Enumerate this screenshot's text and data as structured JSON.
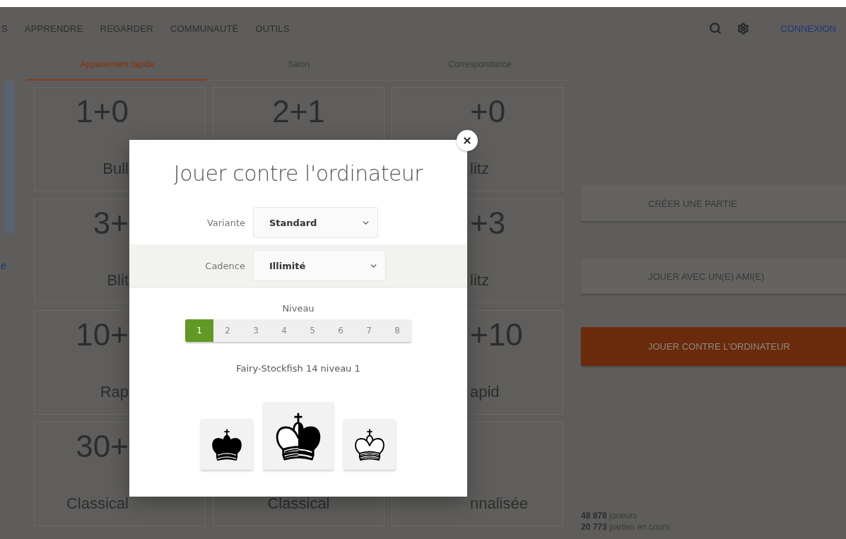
{
  "nav": {
    "items": [
      "S",
      "APPRENDRE",
      "REGARDER",
      "COMMUNAUTÉ",
      "OUTILS"
    ],
    "login": "CONNEXION"
  },
  "left_rail": {
    "link": "e"
  },
  "tabs": [
    {
      "label": "Appariement rapide",
      "selected": true
    },
    {
      "label": "Salon",
      "selected": false
    },
    {
      "label": "Correspondance",
      "selected": false
    }
  ],
  "pools": [
    {
      "kind": "card",
      "time": "1+0",
      "name": "Bull"
    },
    {
      "kind": "card",
      "time": "2+1"
    },
    {
      "kind": "card",
      "time": "+0",
      "name": "litz"
    },
    {
      "kind": "card",
      "time": "3+",
      "name": "Blit"
    },
    {
      "kind": "hidden"
    },
    {
      "kind": "card",
      "time": "+3",
      "name": "litz"
    },
    {
      "kind": "card",
      "time": "10+",
      "name": "Rap"
    },
    {
      "kind": "hidden"
    },
    {
      "kind": "card",
      "time": "+10",
      "name": "apid"
    },
    {
      "kind": "card",
      "time": "30+",
      "name": "Classical"
    },
    {
      "kind": "card",
      "name": "Classical"
    },
    {
      "kind": "card",
      "name": "nnalisée"
    }
  ],
  "actions": [
    {
      "label": "CRÉER UNE PARTIE",
      "kind": "plain"
    },
    {
      "label": "JOUER AVEC UN(E) AMI(E)",
      "kind": "plain"
    },
    {
      "label": "JOUER CONTRE L'ORDINATEUR",
      "kind": "primary"
    }
  ],
  "stats": [
    "**48 878** joueurs",
    "**20 773** parties en cours"
  ],
  "dialog": {
    "title": "Jouer contre l'ordinateur",
    "fields": [
      {
        "label": "Variante",
        "value": "Standard",
        "highlighted": false
      },
      {
        "label": "Cadence",
        "value": "Illimité",
        "highlighted": true
      }
    ],
    "level": {
      "label": "Niveau",
      "options": [
        {
          "label": "1",
          "selected": true
        },
        {
          "label": "2",
          "selected": false
        },
        {
          "label": "3",
          "selected": false
        },
        {
          "label": "4",
          "selected": false
        },
        {
          "label": "5",
          "selected": false
        },
        {
          "label": "6",
          "selected": false
        },
        {
          "label": "7",
          "selected": false
        },
        {
          "label": "8",
          "selected": false
        }
      ]
    },
    "engine": "Fairy-Stockfish 14 niveau 1",
    "sides": [
      {
        "kind": "black"
      },
      {
        "kind": "random"
      },
      {
        "kind": "white"
      }
    ]
  }
}
